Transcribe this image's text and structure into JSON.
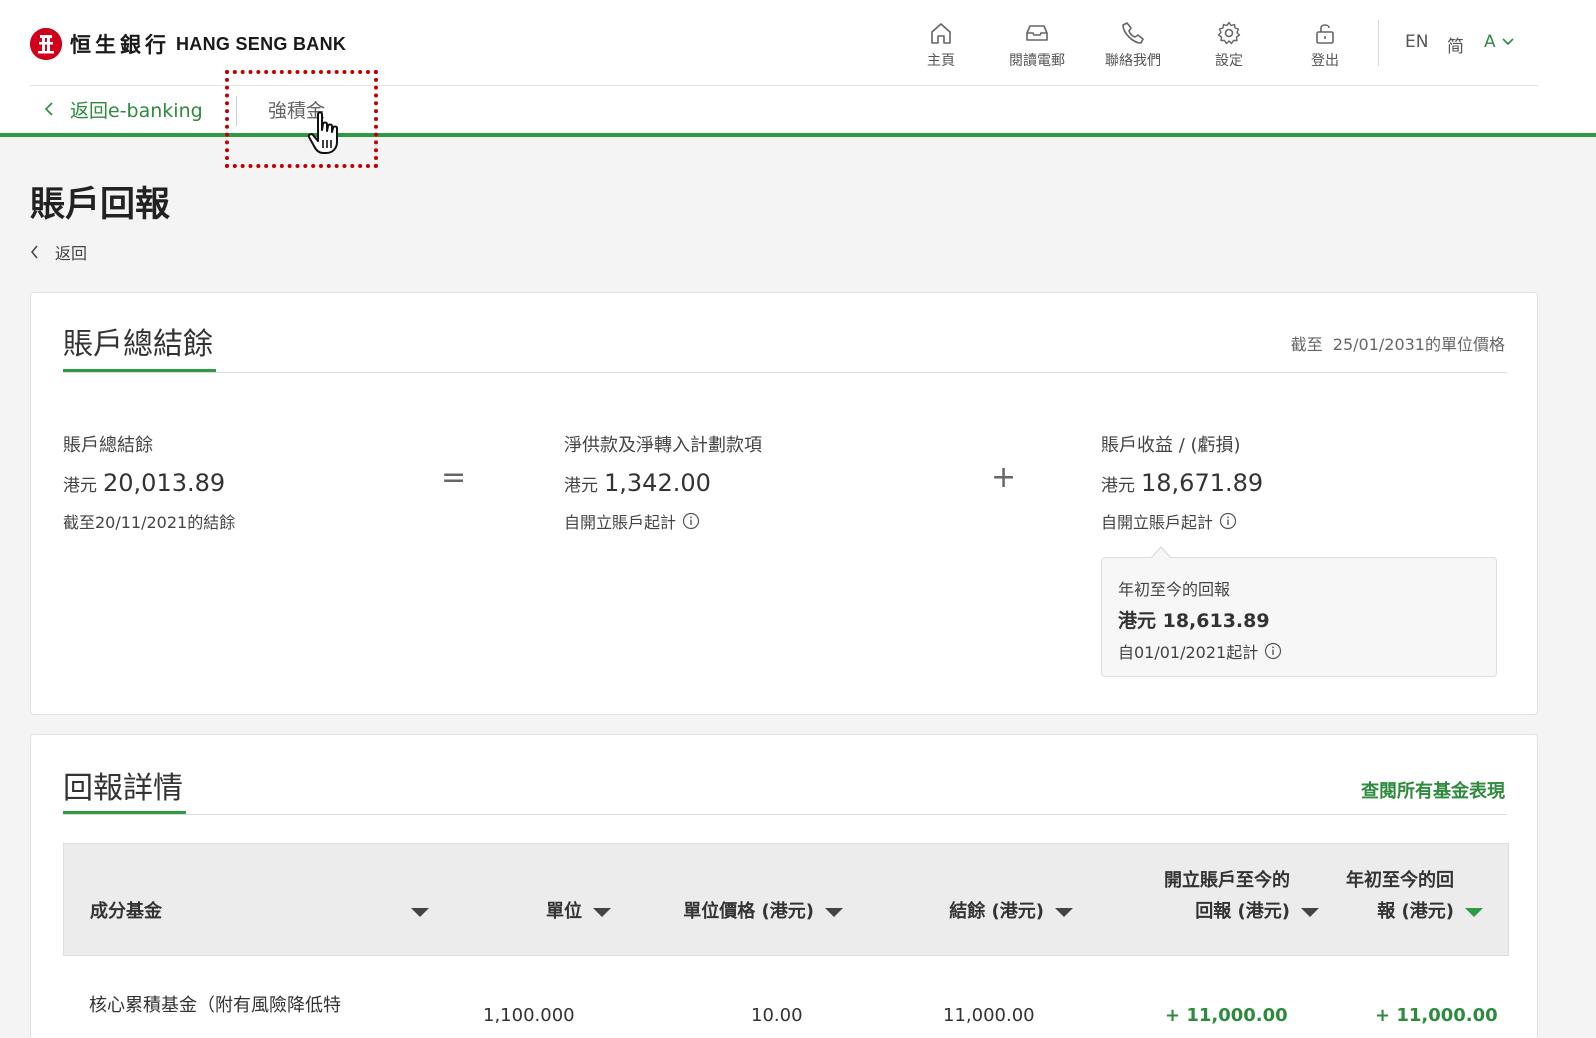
{
  "brand": {
    "cn": "恒生銀行",
    "en": "HANG SENG BANK"
  },
  "nav": [
    {
      "label": "主頁",
      "icon": "home-icon"
    },
    {
      "label": "閱讀電郵",
      "icon": "inbox-icon"
    },
    {
      "label": "聯絡我們",
      "icon": "phone-icon"
    },
    {
      "label": "設定",
      "icon": "gear-icon"
    },
    {
      "label": "登出",
      "icon": "unlock-icon"
    }
  ],
  "lang": {
    "en": "EN",
    "sc": "简",
    "font_size": "A"
  },
  "subnav": {
    "back": "返回e-banking",
    "tab": "強積金"
  },
  "page": {
    "title": "賬戶回報",
    "back": "返回"
  },
  "summary": {
    "title": "賬戶總結餘",
    "asof_prefix": "截至",
    "asof_value": "25/01/2031的單位價格",
    "total": {
      "label": "賬戶總結餘",
      "currency": "港元",
      "value": "20,013.89",
      "note": "截至20/11/2021的結餘"
    },
    "equals": "=",
    "contrib": {
      "label": "淨供款及淨轉入計劃款項",
      "currency": "港元",
      "value": "1,342.00",
      "note": "自開立賬戶起計"
    },
    "plus": "+",
    "gain": {
      "label": "賬戶收益 / (虧損)",
      "currency": "港元",
      "value": "18,671.89",
      "note": "自開立賬戶起計"
    },
    "ytd": {
      "label": "年初至今的回報",
      "value": "港元 18,613.89",
      "note": "自01/01/2021起計"
    }
  },
  "details": {
    "title": "回報詳情",
    "view_all": "查閱所有基金表現",
    "columns": [
      {
        "line1": "",
        "line2": "成分基金"
      },
      {
        "line1": "",
        "line2": "單位"
      },
      {
        "line1": "",
        "line2": "單位價格 (港元)"
      },
      {
        "line1": "",
        "line2": "結餘 (港元)"
      },
      {
        "line1": "開立賬戶至今的",
        "line2": "回報 (港元)"
      },
      {
        "line1": "年初至今的回",
        "line2": "報 (港元)"
      }
    ],
    "rows": [
      {
        "fund": "核心累積基金（附有風險降低特",
        "units": "1,100.000",
        "price": "10.00",
        "balance": "11,000.00",
        "since_open": "+ 11,000.00",
        "ytd": "+ 11,000.00"
      }
    ]
  },
  "colors": {
    "accent": "#2e9a43",
    "brand_red": "#d0021b",
    "highlight": "#c00000"
  }
}
